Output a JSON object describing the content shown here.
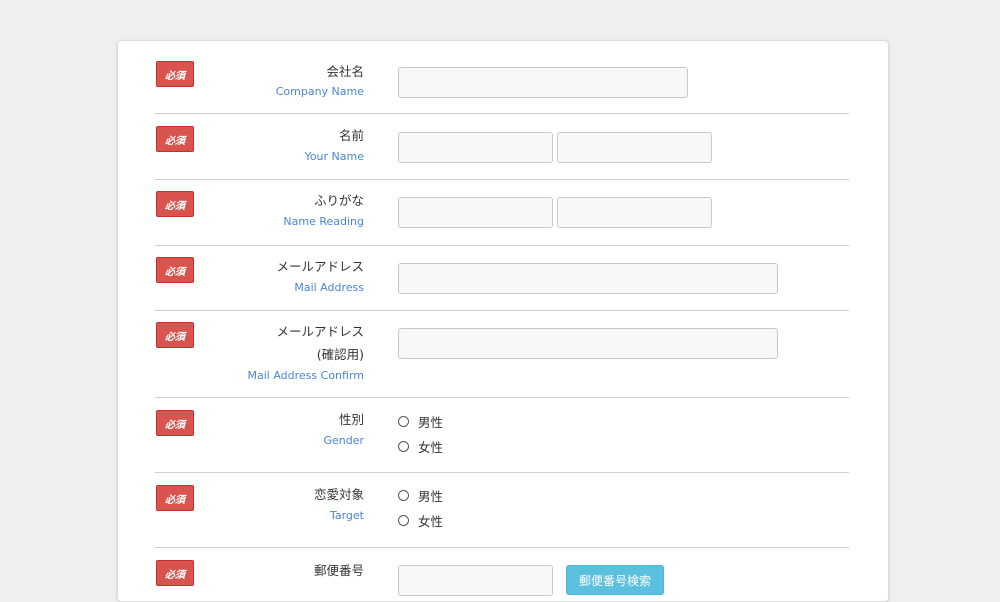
{
  "badge": "必須",
  "rows": {
    "company": {
      "ja": "会社名",
      "en": "Company Name"
    },
    "name": {
      "ja": "名前",
      "en": "Your Name"
    },
    "reading": {
      "ja": "ふりがな",
      "en": "Name Reading"
    },
    "mail": {
      "ja": "メールアドレス",
      "en": "Mail Address"
    },
    "mail_confirm": {
      "ja1": "メールアドレス",
      "ja2": "(確認用)",
      "en": "Mail Address Confirm"
    },
    "gender": {
      "ja": "性別",
      "en": "Gender",
      "options": [
        "男性",
        "女性"
      ]
    },
    "target": {
      "ja": "恋愛対象",
      "en": "Target",
      "options": [
        "男性",
        "女性"
      ]
    },
    "postal": {
      "ja": "郵便番号",
      "button": "郵便番号検索"
    }
  }
}
